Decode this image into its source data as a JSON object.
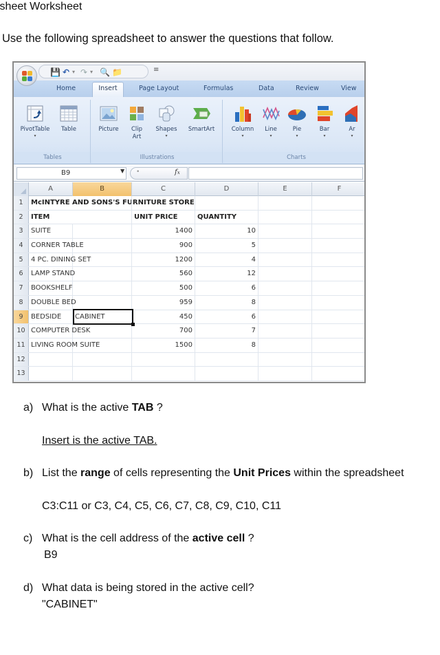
{
  "document": {
    "title": "lsheet Worksheet",
    "intro": "Use the following spreadsheet to answer the questions that follow."
  },
  "excel": {
    "quick_access_icons": [
      "save-icon",
      "undo-icon",
      "redo-icon",
      "print-preview-icon",
      "open-icon"
    ],
    "tabs": [
      {
        "label": "Home",
        "active": false
      },
      {
        "label": "Insert",
        "active": true
      },
      {
        "label": "Page Layout",
        "active": false
      },
      {
        "label": "Formulas",
        "active": false
      },
      {
        "label": "Data",
        "active": false
      },
      {
        "label": "Review",
        "active": false
      },
      {
        "label": "View",
        "active": false
      }
    ],
    "ribbon_groups": [
      {
        "label": "Tables",
        "buttons": [
          {
            "label": "PivotTable",
            "icon": "pivottable-icon",
            "dropdown": true
          },
          {
            "label": "Table",
            "icon": "table-icon",
            "dropdown": false
          }
        ]
      },
      {
        "label": "Illustrations",
        "buttons": [
          {
            "label": "Picture",
            "icon": "picture-icon",
            "dropdown": false
          },
          {
            "label": "Clip Art",
            "icon": "clip-art-icon",
            "dropdown": false
          },
          {
            "label": "Shapes",
            "icon": "shapes-icon",
            "dropdown": true
          },
          {
            "label": "SmartArt",
            "icon": "smartart-icon",
            "dropdown": false
          }
        ]
      },
      {
        "label": "Charts",
        "buttons": [
          {
            "label": "Column",
            "icon": "column-chart-icon",
            "dropdown": true
          },
          {
            "label": "Line",
            "icon": "line-chart-icon",
            "dropdown": true
          },
          {
            "label": "Pie",
            "icon": "pie-chart-icon",
            "dropdown": true
          },
          {
            "label": "Bar",
            "icon": "bar-chart-icon",
            "dropdown": true
          },
          {
            "label": "Ar",
            "icon": "area-chart-icon",
            "dropdown": true
          }
        ]
      }
    ],
    "name_box": "B9",
    "formula_value": "",
    "column_headers": [
      "A",
      "B",
      "C",
      "D",
      "E",
      "F"
    ],
    "selected_column": "B",
    "selected_row": 9,
    "active_cell": "B9",
    "rows": [
      {
        "n": "1",
        "A": "McINTYRE AND SONS'S FURNITURE STORE",
        "C": "",
        "D": ""
      },
      {
        "n": "2",
        "A": "ITEM",
        "C": "UNIT PRICE",
        "D": "QUANTITY"
      },
      {
        "n": "3",
        "A": "SUITE",
        "C": "1400",
        "D": "10"
      },
      {
        "n": "4",
        "A": "CORNER TABLE",
        "C": "900",
        "D": "5"
      },
      {
        "n": "5",
        "A": "4 PC. DINING SET",
        "C": "1200",
        "D": "4"
      },
      {
        "n": "6",
        "A": "LAMP STAND",
        "C": "560",
        "D": "12"
      },
      {
        "n": "7",
        "A": "BOOKSHELF",
        "C": "500",
        "D": "6"
      },
      {
        "n": "8",
        "A": "DOUBLE BED",
        "C": "959",
        "D": "8"
      },
      {
        "n": "9",
        "A": "BEDSIDE",
        "B": "CABINET",
        "C": "450",
        "D": "6"
      },
      {
        "n": "10",
        "A": "COMPUTER DESK",
        "C": "700",
        "D": "7"
      },
      {
        "n": "11",
        "A": "LIVING ROOM SUITE",
        "C": "1500",
        "D": "8"
      },
      {
        "n": "12",
        "A": "",
        "C": "",
        "D": ""
      },
      {
        "n": "13",
        "A": "",
        "C": "",
        "D": ""
      }
    ]
  },
  "questions": [
    {
      "label": "a)",
      "pre": "What is the active ",
      "bold": "TAB",
      "post": " ?",
      "answer": "Insert is the active TAB."
    },
    {
      "label": "b)",
      "pre": "List the ",
      "bold": "range",
      "mid": " of cells representing the ",
      "bold2": "Unit Prices",
      "post": " within the spreadsheet",
      "answer": "C3:C11 or C3, C4, C5, C6, C7, C8, C9, C10, C11"
    },
    {
      "label": "c)",
      "pre": "What is the cell address of the ",
      "bold": "active cell",
      "post": " ?",
      "answer": "B9"
    },
    {
      "label": "d)",
      "pre": "What data is being stored in the active cell?",
      "answer": "\"CABINET\""
    }
  ]
}
